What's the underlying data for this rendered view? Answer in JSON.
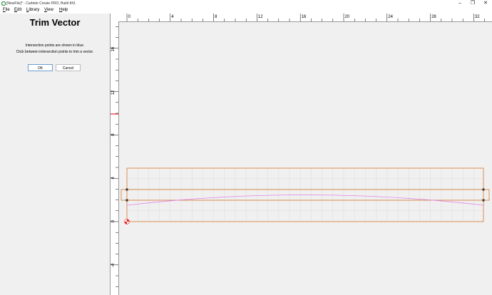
{
  "window": {
    "title": "[NewFile]* - Carbide Create PRO, Build 841",
    "app_icon": "carbide-logo-icon",
    "controls": [
      "minimize-icon",
      "restore-icon",
      "close-icon"
    ]
  },
  "menu": {
    "items": [
      "File",
      "Edit",
      "Library",
      "View",
      "Help"
    ]
  },
  "panel": {
    "title": "Trim Vector",
    "message_line1": "Intersection points are shown in blue.",
    "message_line2": "Click between intersection points to trim a vector.",
    "ok_label": "OK",
    "cancel_label": "Cancel"
  },
  "rulers": {
    "top_labels": [
      "0",
      "4",
      "8",
      "12",
      "16",
      "20",
      "24",
      "28",
      "32"
    ],
    "left_labels": [
      "16",
      "12",
      "8",
      "4",
      "0",
      "-4"
    ]
  },
  "colors": {
    "stock_outline": "#d87a2e",
    "arc_vector": "#e283e8",
    "origin_marker": "#e8262a",
    "grid": "#dcdcdc",
    "ruler_marker": "#e8262a"
  }
}
